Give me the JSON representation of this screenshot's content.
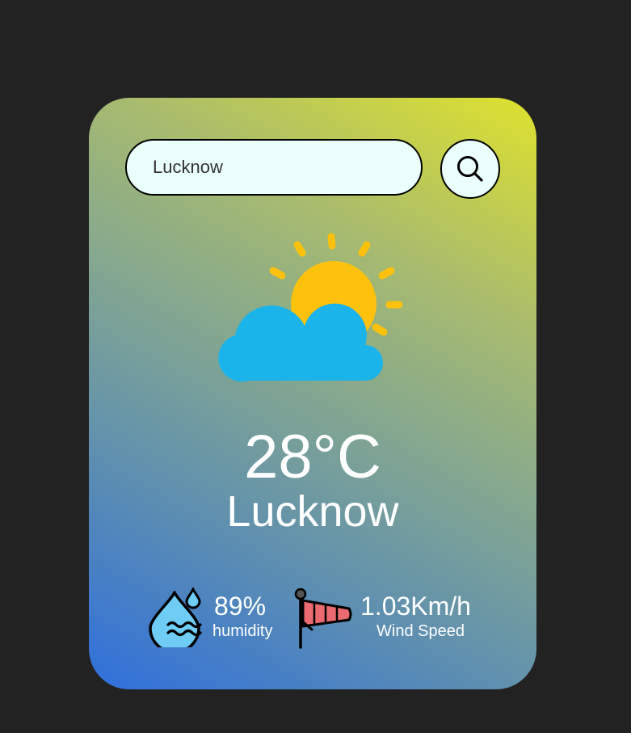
{
  "search": {
    "value": "Lucknow",
    "placeholder": "Lucknow"
  },
  "weather": {
    "condition_icon": "partly-cloudy-icon",
    "temperature": "28°C",
    "city": "Lucknow"
  },
  "stats": {
    "humidity": {
      "value": "89%",
      "label": "humidity",
      "icon": "humidity-icon"
    },
    "wind": {
      "value": "1.03Km/h",
      "label": "Wind Speed",
      "icon": "windsock-icon"
    }
  },
  "colors": {
    "background": "#222222",
    "card_gradient_top": "#dfe22e",
    "card_gradient_bottom": "#2f6fdc",
    "input_background": "#ebfffb",
    "sun": "#fec10e",
    "cloud": "#1ab3ea",
    "text": "#ffffff"
  }
}
